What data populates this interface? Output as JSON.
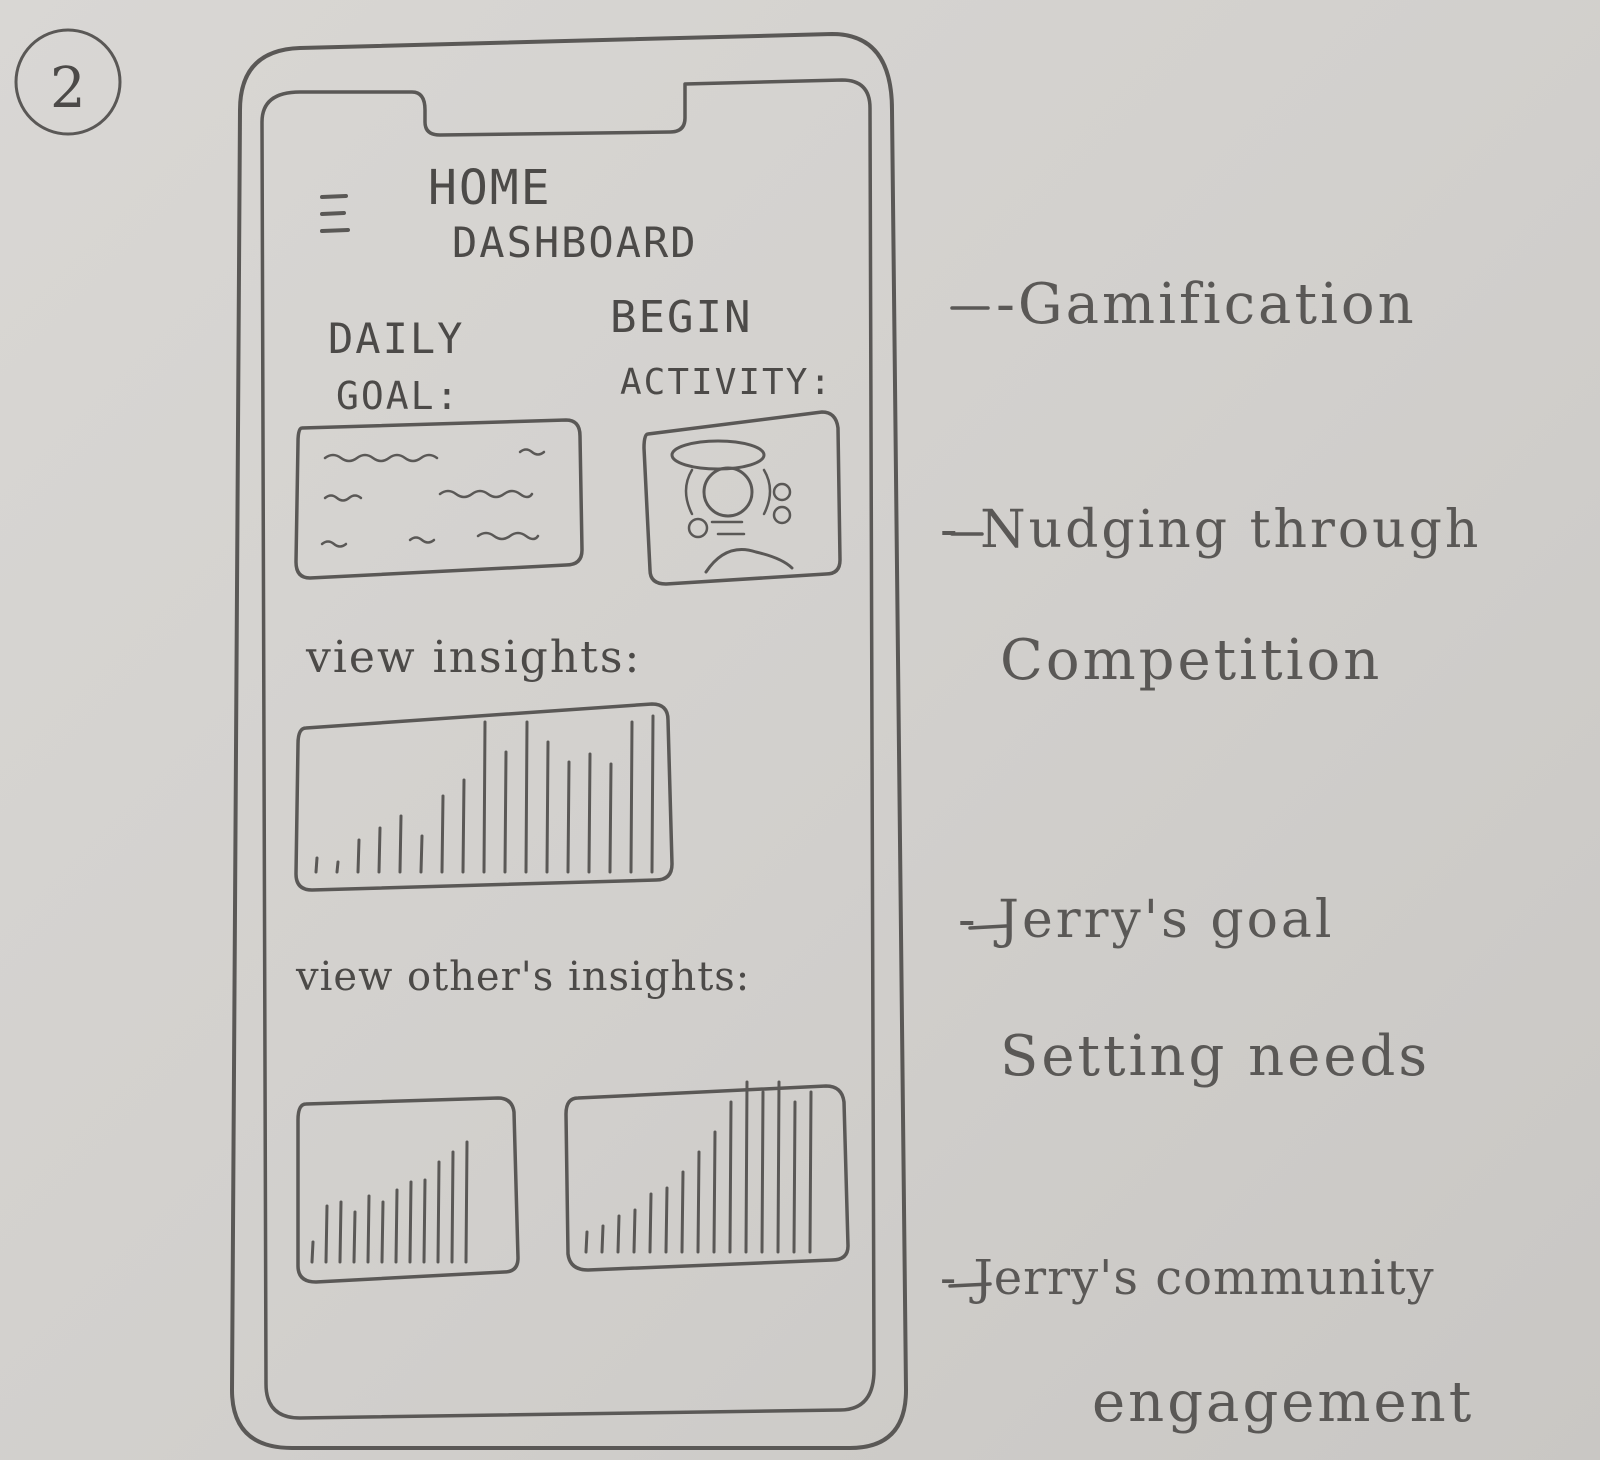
{
  "page_number": "2",
  "phone": {
    "header": {
      "menu_icon": "hamburger-icon",
      "title_line1": "HOME",
      "title_line2": "DASHBOARD"
    },
    "daily_goal": {
      "label_line1": "DAILY",
      "label_line2": "GOAL:"
    },
    "begin_activity": {
      "label_line1": "BEGIN",
      "label_line2": "ACTIVITY:",
      "icon": "character-avatar-icon"
    },
    "insights": {
      "label": "view insights:"
    },
    "others_insights": {
      "label": "view other's insights:"
    }
  },
  "annotations": [
    "-Gamification",
    "- Nudging through",
    "Competition",
    "- Jerry's goal",
    "Setting needs",
    "- Jerry's community",
    "engagement"
  ],
  "colors": {
    "paper": "#d6d4d1",
    "pencil": "#5a5856"
  }
}
